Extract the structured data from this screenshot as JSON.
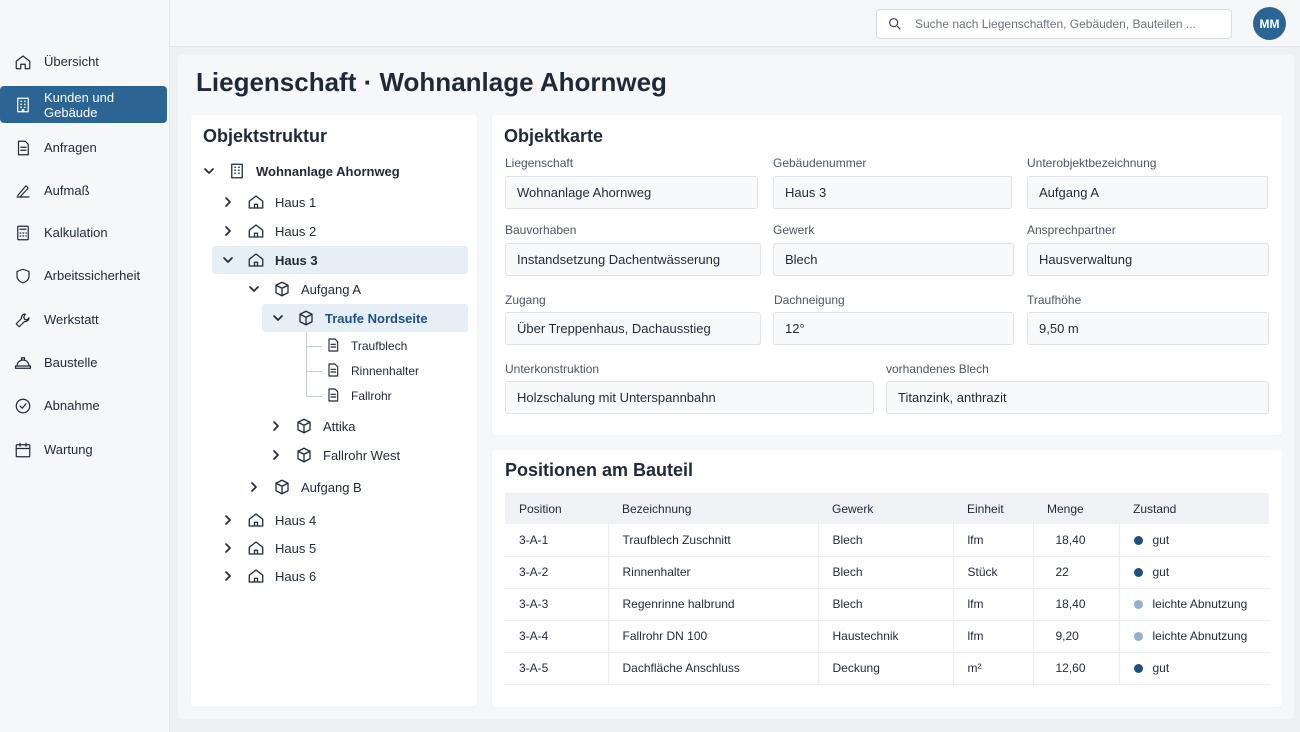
{
  "sidebar": {
    "items": [
      {
        "label": "Übersicht",
        "icon": "home-icon"
      },
      {
        "label": "Kunden und Gebäude",
        "icon": "building-icon"
      },
      {
        "label": "Anfragen",
        "icon": "document-icon"
      },
      {
        "label": "Aufmaß",
        "icon": "measure-icon"
      },
      {
        "label": "Kalkulation",
        "icon": "calculator-icon"
      },
      {
        "label": "Arbeitssicherheit",
        "icon": "shield-icon"
      },
      {
        "label": "Werkstatt",
        "icon": "wrench-icon"
      },
      {
        "label": "Baustelle",
        "icon": "hardhat-icon"
      },
      {
        "label": "Abnahme",
        "icon": "check-circle-icon"
      },
      {
        "label": "Wartung",
        "icon": "calendar-icon"
      }
    ],
    "active_index": 1
  },
  "topbar": {
    "search_placeholder": "Suche nach Liegenschaften, Gebäuden, Bauteilen ...",
    "avatar_initials": "MM"
  },
  "page": {
    "title": "Liegenschaft · Wohnanlage Ahornweg"
  },
  "tree": {
    "title": "Objektstruktur",
    "root": "Wohnanlage Ahornweg",
    "haus1": "Haus 1",
    "haus2": "Haus 2",
    "haus3": "Haus 3",
    "aufgang_a": "Aufgang A",
    "traufe": "Traufe Nordseite",
    "traufblech": "Traufblech",
    "rinnenhalter": "Rinnenhalter",
    "fallrohr": "Fallrohr",
    "attika": "Attika",
    "fallrohr_west": "Fallrohr West",
    "aufgang_b": "Aufgang B",
    "haus4": "Haus 4",
    "haus5": "Haus 5",
    "haus6": "Haus 6"
  },
  "objektkarte": {
    "title": "Objektkarte",
    "fields": {
      "liegenschaft": {
        "label": "Liegenschaft",
        "value": "Wohnanlage Ahornweg"
      },
      "gebaeudenummer": {
        "label": "Gebäudenummer",
        "value": "Haus 3"
      },
      "unterobjekt": {
        "label": "Unterobjektbezeichnung",
        "value": "Aufgang A"
      },
      "bauvorhaben": {
        "label": "Bauvorhaben",
        "value": "Instandsetzung Dachentwässerung"
      },
      "gewerk": {
        "label": "Gewerk",
        "value": "Blech"
      },
      "ansprechpartner": {
        "label": "Ansprechpartner",
        "value": "Hausverwaltung"
      },
      "zugang": {
        "label": "Zugang",
        "value": "Über Treppenhaus, Dachausstieg"
      },
      "dachneigung": {
        "label": "Dachneigung",
        "value": "12°"
      },
      "traufhoehe": {
        "label": "Traufhöhe",
        "value": "9,50 m"
      },
      "unterkonstruktion": {
        "label": "Unterkonstruktion",
        "value": "Holzschalung mit Unterspannbahn"
      },
      "blech": {
        "label": "vorhandenes Blech",
        "value": "Titanzink, anthrazit"
      }
    }
  },
  "positionen": {
    "title": "Positionen am Bauteil",
    "headers": [
      "Position",
      "Bezeichnung",
      "Gewerk",
      "Einheit",
      "Menge",
      "Zustand"
    ],
    "rows": [
      {
        "position": "3-A-1",
        "bezeichnung": "Traufblech Zuschnitt",
        "gewerk": "Blech",
        "einheit": "lfm",
        "menge": "18,40",
        "zustand": "gut"
      },
      {
        "position": "3-A-2",
        "bezeichnung": "Rinnenhalter",
        "gewerk": "Blech",
        "einheit": "Stück",
        "menge": "22",
        "zustand": "gut"
      },
      {
        "position": "3-A-3",
        "bezeichnung": "Regenrinne halbrund",
        "gewerk": "Blech",
        "einheit": "lfm",
        "menge": "18,40",
        "zustand": "leichte Abnutzung"
      },
      {
        "position": "3-A-4",
        "bezeichnung": "Fallrohr DN 100",
        "gewerk": "Haustechnik",
        "einheit": "lfm",
        "menge": "9,20",
        "zustand": "leichte Abnutzung"
      },
      {
        "position": "3-A-5",
        "bezeichnung": "Dachfläche Anschluss",
        "gewerk": "Deckung",
        "einheit": "m²",
        "menge": "12,60",
        "zustand": "gut"
      }
    ]
  },
  "colors": {
    "accent": "#2c6594",
    "status_gut": "#1f4f86",
    "status_abnutzung": "#8fb1d2"
  }
}
